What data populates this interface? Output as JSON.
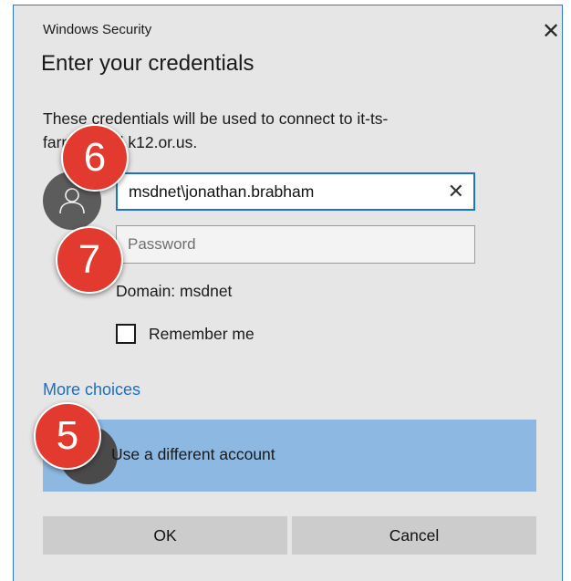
{
  "window": {
    "title": "Windows Security",
    "close_icon": "close-icon",
    "close_glyph": "✕"
  },
  "heading": "Enter your credentials",
  "description": "These credentials will be used to connect to it-ts-farmingford.k12.or.us.",
  "username": {
    "value": "msdnet\\jonathan.brabham",
    "clear_glyph": "✕"
  },
  "password": {
    "placeholder": "Password",
    "value": ""
  },
  "domain_text": "Domain: msdnet",
  "remember_me": {
    "label": "Remember me",
    "checked": false
  },
  "more_choices": "More choices",
  "options": [
    {
      "label": "Use a different account",
      "icon": "user-icon"
    }
  ],
  "buttons": {
    "ok": "OK",
    "cancel": "Cancel"
  },
  "markers": {
    "m5": "5",
    "m6": "6",
    "m7": "7"
  },
  "colors": {
    "dialog_bg": "#e6e6e6",
    "accent": "#1c73c9",
    "link": "#1a6fc6",
    "selected_option": "#8cb8e2",
    "marker": "#e23a2e"
  }
}
